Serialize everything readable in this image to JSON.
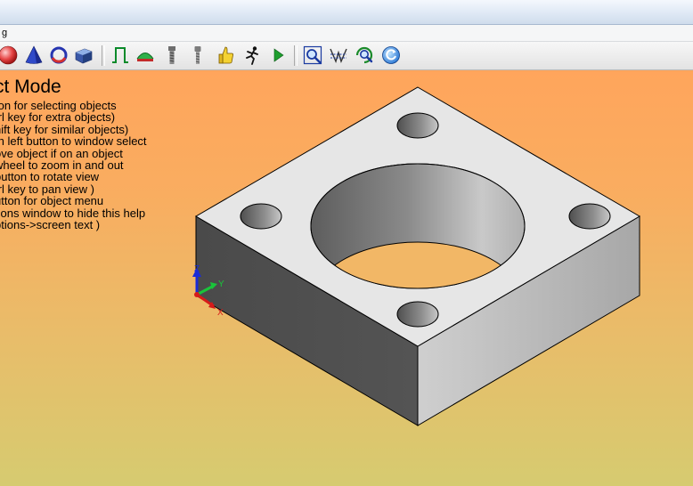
{
  "menubar": {
    "visible_item": "g"
  },
  "toolbar": {
    "buttons": [
      {
        "id": "sphere",
        "icon": "sphere-icon"
      },
      {
        "id": "cone",
        "icon": "cone-icon"
      },
      {
        "id": "torus",
        "icon": "torus-icon"
      },
      {
        "id": "wedge",
        "icon": "wedge-icon"
      },
      {
        "id": "extrude",
        "icon": "extrude-icon"
      },
      {
        "id": "revolve",
        "icon": "revolve-icon"
      },
      {
        "id": "bolt",
        "icon": "bolt-icon"
      },
      {
        "id": "screw",
        "icon": "screw-icon"
      },
      {
        "id": "thumbs-up",
        "icon": "thumbs-up-icon"
      },
      {
        "id": "run",
        "icon": "running-man-icon"
      },
      {
        "id": "play",
        "icon": "play-icon"
      },
      {
        "id": "zoom-window",
        "icon": "zoom-window-icon"
      },
      {
        "id": "zoom-all",
        "icon": "zoom-extents-icon"
      },
      {
        "id": "zoom-dynamic",
        "icon": "zoom-dynamic-icon"
      },
      {
        "id": "rotate-view",
        "icon": "rotate-view-icon"
      }
    ]
  },
  "help": {
    "title": "ct Mode",
    "lines": [
      "ton for selecting objects",
      "trl key for extra objects)",
      "hift key for similar objects)",
      "th left button to window select",
      "ove object if on an object",
      "wheel to zoom in and out",
      "button to rotate view",
      "trl key to pan view )",
      "utton for object menu",
      "tions window to hide this help",
      "ptions->screen text )"
    ]
  },
  "axes": {
    "z_label": "Z",
    "y_label": "Y",
    "x_label": "X",
    "colors": {
      "z": "#1a2bd6",
      "y": "#19c43a",
      "x": "#d61a1a"
    }
  },
  "colors": {
    "background_top": "#ffa55c",
    "background_bottom": "#d6cb70",
    "part_top": "#e8e8e8",
    "part_left_side": "#4d4d4d",
    "part_right_side": "#b5b5b5"
  }
}
